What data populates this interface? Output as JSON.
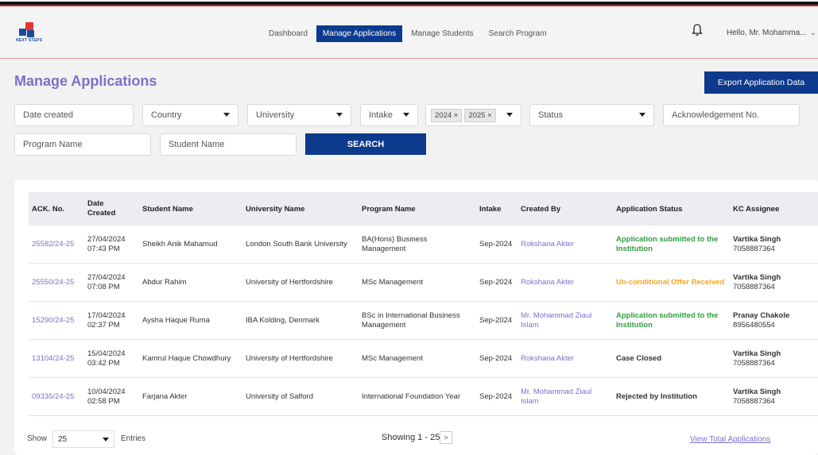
{
  "header": {
    "logo_text": "NEXT STEPS",
    "nav": [
      "Dashboard",
      "Manage Applications",
      "Manage Students",
      "Search Program"
    ],
    "active_index": 1,
    "greeting": "Hello, Mr. Mohamma..."
  },
  "page": {
    "title": "Manage Applications",
    "export_label": "Export Application Data"
  },
  "filters": {
    "date_created": "Date created",
    "country": "Country",
    "university": "University",
    "intake": "Intake",
    "year_chips": [
      "2024 ×",
      "2025 ×"
    ],
    "status": "Status",
    "ack_no": "Acknowledgement No.",
    "program_name": "Program Name",
    "student_name": "Student Name",
    "search_label": "SEARCH"
  },
  "table": {
    "columns": [
      "ACK. No.",
      "Date Created",
      "Student Name",
      "University Name",
      "Program Name",
      "Intake",
      "Created By",
      "Application Status",
      "KC Assignee"
    ],
    "rows": [
      {
        "ack": "25582/24-25",
        "date": "27/04/2024",
        "time": "07:43 PM",
        "student": "Sheikh Anik Mahamud",
        "university": "London South Bank University",
        "program": "BA(Hons) Business Management",
        "intake": "Sep-2024",
        "created_by": "Rokshana Akter",
        "status": "Application submitted to the Institution",
        "status_color": "green",
        "assignee": "Vartika Singh",
        "phone": "7058887364"
      },
      {
        "ack": "25550/24-25",
        "date": "27/04/2024",
        "time": "07:08 PM",
        "student": "Abdur Rahim",
        "university": "University of Hertfordshire",
        "program": "MSc Management",
        "intake": "Sep-2024",
        "created_by": "Rokshana Akter",
        "status": "Un-conditional Offer Received",
        "status_color": "orange",
        "assignee": "Vartika Singh",
        "phone": "7058887364"
      },
      {
        "ack": "15290/24-25",
        "date": "17/04/2024",
        "time": "02:37 PM",
        "student": "Aysha Haque Ruma",
        "university": "IBA Kolding, Denmark",
        "program": "BSc in International Business Management",
        "intake": "Sep-2024",
        "created_by": "Mr. Mohammad Ziaul Islam",
        "status": "Application submitted to the Institution",
        "status_color": "green",
        "assignee": "Pranay Chakole",
        "phone": "8956480554"
      },
      {
        "ack": "13104/24-25",
        "date": "15/04/2024",
        "time": "03:42 PM",
        "student": "Kamrul Haque Chowdhury",
        "university": "University of Hertfordshire",
        "program": "MSc Management",
        "intake": "Sep-2024",
        "created_by": "Rokshana Akter",
        "status": "Case Closed",
        "status_color": "dark",
        "assignee": "Vartika Singh",
        "phone": "7058887364"
      },
      {
        "ack": "09335/24-25",
        "date": "10/04/2024",
        "time": "02:58 PM",
        "student": "Farjana Akter",
        "university": "University of Salford",
        "program": "International Foundation Year",
        "intake": "Sep-2024",
        "created_by": "Mr. Mohammad Ziaul Islam",
        "status": "Rejected by Institution",
        "status_color": "dark",
        "assignee": "Vartika Singh",
        "phone": "7058887364"
      }
    ]
  },
  "footer": {
    "show_label": "Show",
    "entries_value": "25",
    "entries_label": "Entries",
    "showing": "Showing 1 - 25",
    "next": ">",
    "view_total": "View Total Applications"
  }
}
